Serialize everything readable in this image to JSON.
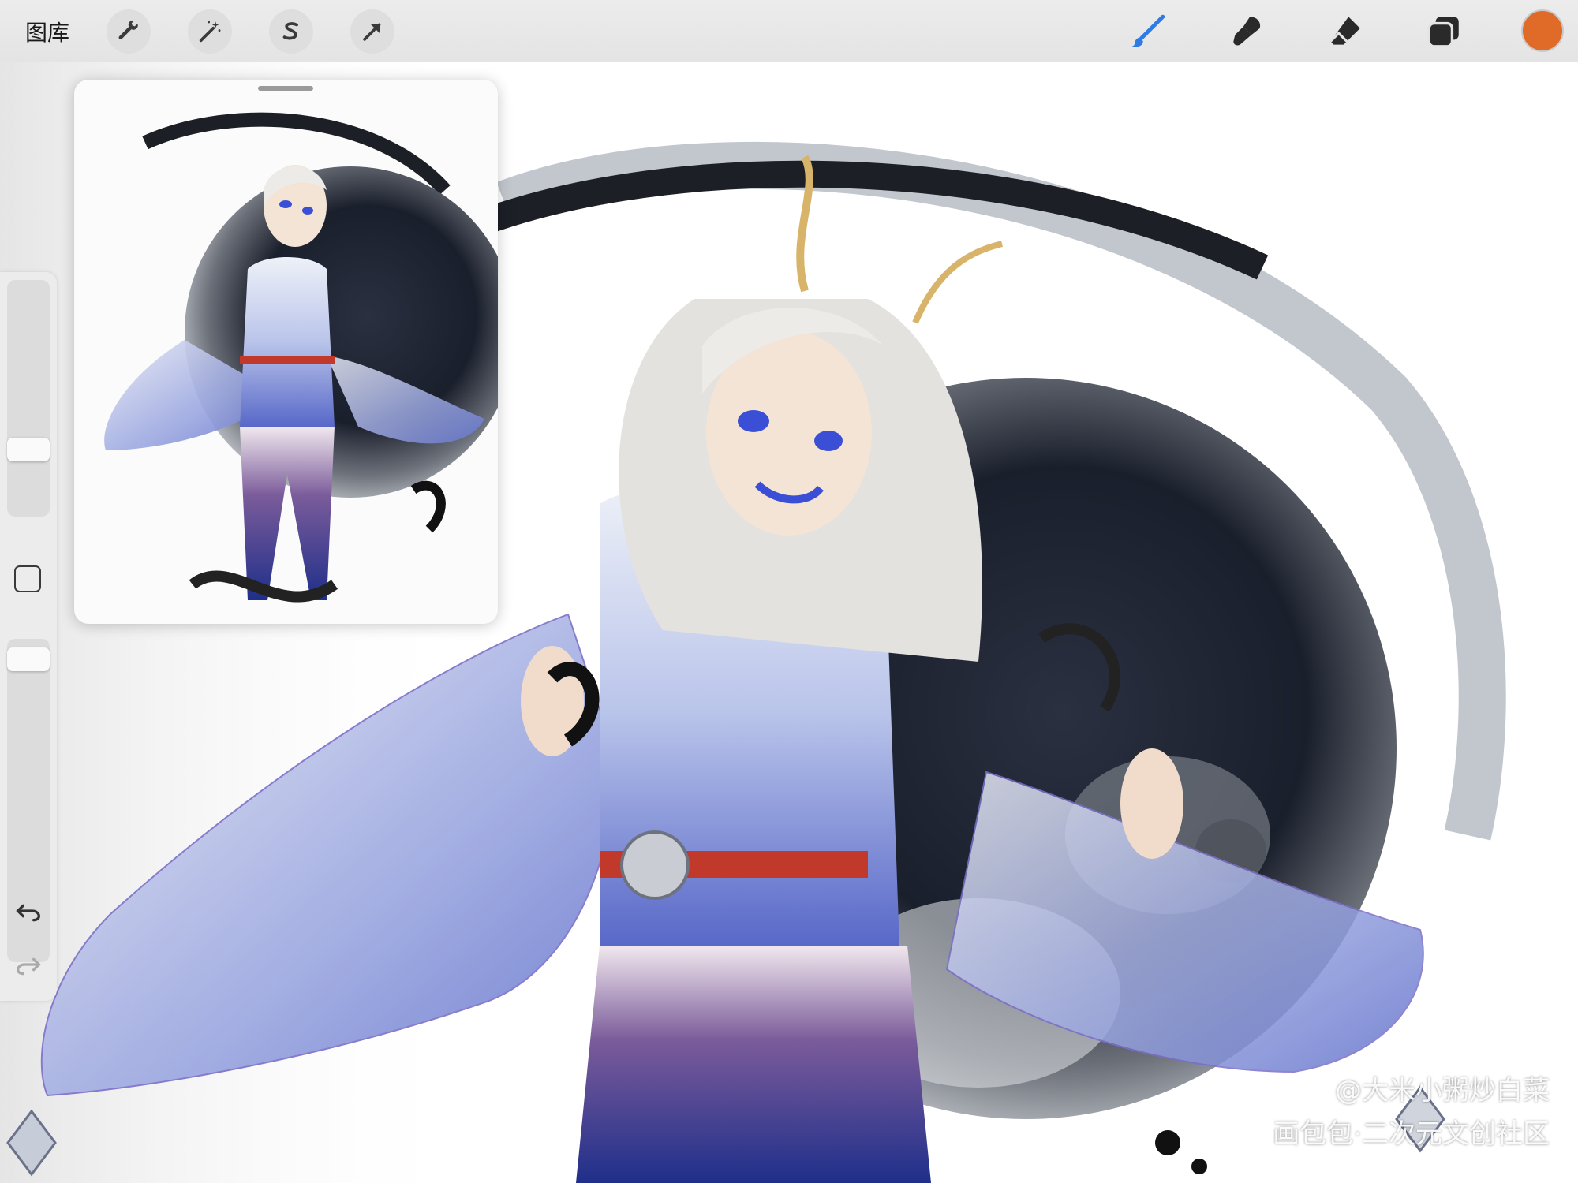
{
  "toolbar": {
    "gallery_label": "图库",
    "left_tools": [
      "wrench-icon",
      "magic-wand-icon",
      "selection-icon",
      "transform-arrow-icon"
    ],
    "right_tools": [
      "brush-icon",
      "smudge-icon",
      "eraser-icon",
      "layers-icon"
    ],
    "active_tool": "brush-icon",
    "current_color": "#e06a27",
    "active_tint": "#2f7be6"
  },
  "sidebar": {
    "brush_size_level": 0.26,
    "opacity_level": 0.97,
    "buttons": [
      "modify-button",
      "undo-icon",
      "redo-icon"
    ]
  },
  "watermark": {
    "line1": "@大米小粥炒白菜",
    "line2": "画包包·二次元文创社区"
  }
}
